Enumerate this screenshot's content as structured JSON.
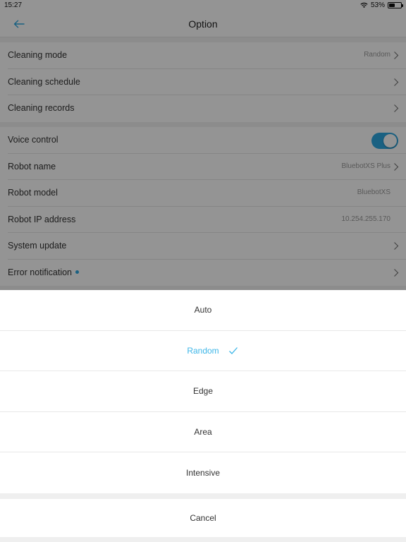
{
  "status_bar": {
    "time": "15:27",
    "battery": "53%",
    "battery_level": 0.53
  },
  "header": {
    "title": "Option"
  },
  "groups": [
    {
      "items": [
        {
          "label": "Cleaning mode",
          "value": "Random"
        },
        {
          "label": "Cleaning schedule",
          "value": ""
        },
        {
          "label": "Cleaning records",
          "value": ""
        }
      ]
    },
    {
      "items": [
        {
          "label": "Voice control",
          "toggle": true
        },
        {
          "label": "Robot name",
          "value": "BluebotXS Plus"
        },
        {
          "label": "Robot model",
          "value": "BluebotXS"
        },
        {
          "label": "Robot IP address",
          "value": "10.254.255.170"
        },
        {
          "label": "System update",
          "value": ""
        },
        {
          "label": "Error notification",
          "value": ""
        }
      ]
    }
  ],
  "action_sheet": {
    "options": [
      "Auto",
      "Random",
      "Edge",
      "Area",
      "Intensive"
    ],
    "selected": "Random",
    "cancel_label": "Cancel"
  },
  "colors": {
    "accent": "#2ea7e0",
    "selected_text": "#3db6e8",
    "overlay": "rgba(0,0,0,0.42)"
  },
  "icons": [
    "back-arrow-icon",
    "chevron-right-icon",
    "check-icon",
    "wifi-icon",
    "battery-icon"
  ]
}
